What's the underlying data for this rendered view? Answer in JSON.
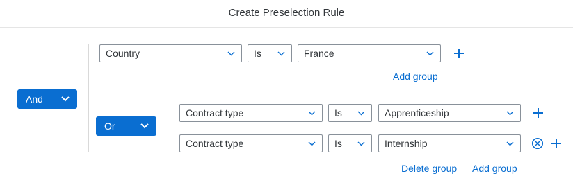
{
  "title": "Create Preselection Rule",
  "colors": {
    "accent": "#0a6ed1",
    "text": "#32363a",
    "border": "#89919a"
  },
  "root": {
    "operator": "And",
    "conditions": [
      {
        "field": "Country",
        "operator": "Is",
        "value": "France",
        "add_group_label": "Add group"
      }
    ],
    "group": {
      "operator": "Or",
      "conditions": [
        {
          "field": "Contract type",
          "operator": "Is",
          "value": "Apprenticeship"
        },
        {
          "field": "Contract type",
          "operator": "Is",
          "value": "Internship"
        }
      ],
      "delete_group_label": "Delete group",
      "add_group_label": "Add group"
    }
  },
  "icons": {
    "dropdown": "chevron-down-icon",
    "add": "plus-icon",
    "remove": "circle-x-icon"
  }
}
